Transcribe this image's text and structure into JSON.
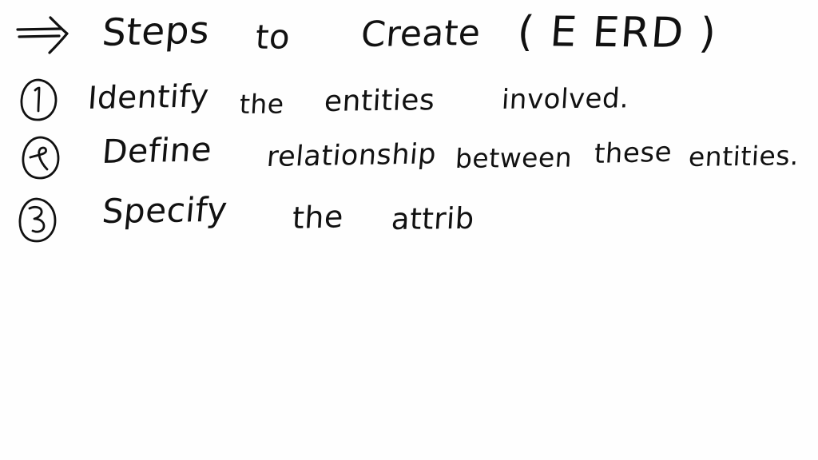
{
  "page": {
    "kind": "handwritten-note",
    "ink_color": "#111111",
    "background_color": "#fefefe",
    "full_text": "=> Steps to Create (E ERD)  (1) Identify the entities involved.  (2) Define relationship between these entities.  (3) Specify the attrib"
  },
  "title": {
    "arrow_icon": "double-arrow-right-icon",
    "arrow_glyph": "⇒",
    "words": {
      "steps": "Steps",
      "to": "to",
      "create": "Create",
      "parenthetical": "( E ERD )"
    },
    "text": "Steps to Create (E ERD)"
  },
  "steps": [
    {
      "number": "1",
      "marker_icon": "circled-number-one-icon",
      "words": {
        "w1": "Identify",
        "w2": "the",
        "w3": "entities",
        "w4": "involved."
      },
      "text": "Identify the entities involved."
    },
    {
      "number": "2",
      "marker_icon": "circled-number-two-icon",
      "words": {
        "w1": "Define",
        "w2": "relationship",
        "w3": "between",
        "w4": "these",
        "w5": "entities."
      },
      "text": "Define relationship between these entities."
    },
    {
      "number": "3",
      "marker_icon": "circled-number-three-icon",
      "words": {
        "w1": "Specify",
        "w2": "the",
        "w3": "attrib"
      },
      "text": "Specify the attrib"
    }
  ]
}
